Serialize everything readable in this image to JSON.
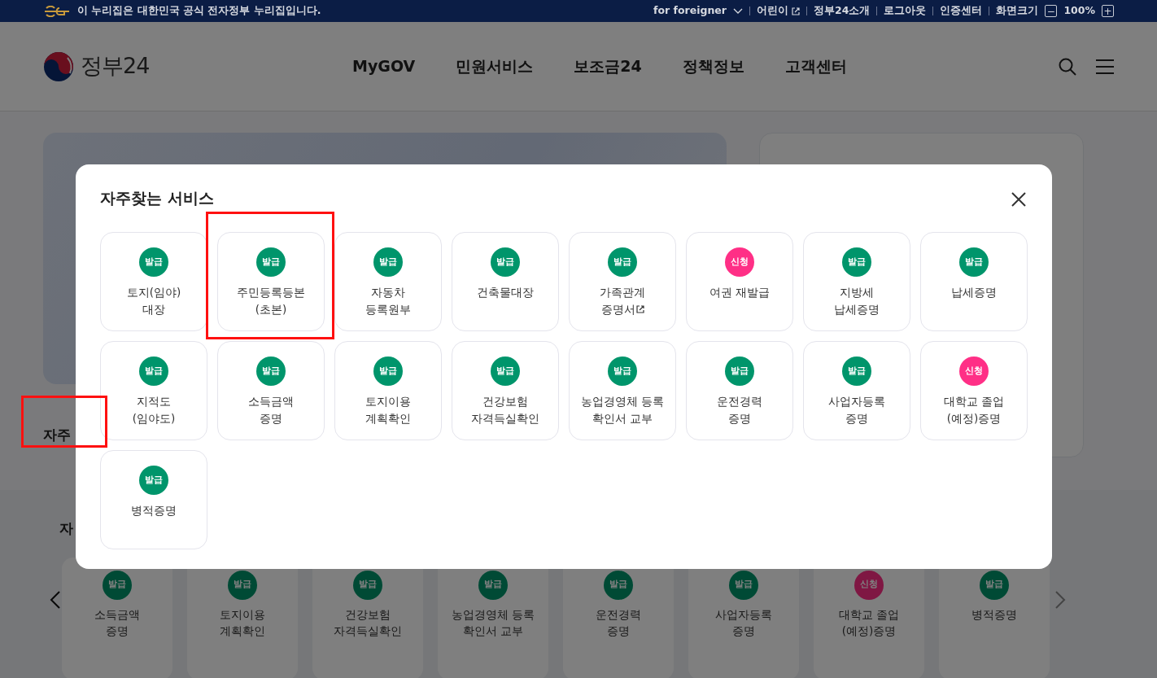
{
  "top_bar": {
    "notice": "이 누리집은 대한민국 공식 전자정부 누리집입니다.",
    "links": [
      {
        "label": "for foreigner",
        "kind": "dropdown"
      },
      {
        "label": "어린이",
        "kind": "external"
      },
      {
        "label": "정부24소개",
        "kind": "plain"
      },
      {
        "label": "로그아웃",
        "kind": "plain"
      },
      {
        "label": "인증센터",
        "kind": "plain"
      }
    ],
    "zoom": {
      "label": "화면크기",
      "decrease": "−",
      "value": "100%",
      "increase": "+"
    }
  },
  "header": {
    "logo": "정부24",
    "nav": [
      "MyGOV",
      "민원서비스",
      "보조금24",
      "정책정보",
      "고객센터"
    ]
  },
  "page": {
    "section_title": {
      "text": "자주",
      "highlighted": true
    },
    "lower_title": "자",
    "carousel": [
      {
        "badge": "발급",
        "kind": "issue",
        "label": "소득금액\n증명"
      },
      {
        "badge": "발급",
        "kind": "issue",
        "label": "토지이용\n계획확인"
      },
      {
        "badge": "발급",
        "kind": "issue",
        "label": "건강보험\n자격득실확인"
      },
      {
        "badge": "발급",
        "kind": "issue",
        "label": "농업경영체 등록\n확인서 교부"
      },
      {
        "badge": "발급",
        "kind": "issue",
        "label": "운전경력\n증명"
      },
      {
        "badge": "발급",
        "kind": "issue",
        "label": "사업자등록\n증명"
      },
      {
        "badge": "신청",
        "kind": "apply",
        "label": "대학교 졸업\n(예정)증명"
      },
      {
        "badge": "발급",
        "kind": "issue",
        "label": "병적증명"
      }
    ]
  },
  "modal": {
    "title": "자주찾는 서비스",
    "services": [
      {
        "badge": "발급",
        "kind": "issue",
        "label": "토지(임야)\n대장",
        "external": false,
        "highlighted": false
      },
      {
        "badge": "발급",
        "kind": "issue",
        "label": "주민등록등본\n(초본)",
        "external": false,
        "highlighted": true
      },
      {
        "badge": "발급",
        "kind": "issue",
        "label": "자동차\n등록원부",
        "external": false,
        "highlighted": false
      },
      {
        "badge": "발급",
        "kind": "issue",
        "label": "건축물대장",
        "external": false,
        "highlighted": false
      },
      {
        "badge": "발급",
        "kind": "issue",
        "label": "가족관계\n증명서",
        "external": true,
        "highlighted": false
      },
      {
        "badge": "신청",
        "kind": "apply",
        "label": "여권 재발급",
        "external": false,
        "highlighted": false
      },
      {
        "badge": "발급",
        "kind": "issue",
        "label": "지방세\n납세증명",
        "external": false,
        "highlighted": false
      },
      {
        "badge": "발급",
        "kind": "issue",
        "label": "납세증명",
        "external": false,
        "highlighted": false
      },
      {
        "badge": "발급",
        "kind": "issue",
        "label": "지적도\n(임야도)",
        "external": false,
        "highlighted": false
      },
      {
        "badge": "발급",
        "kind": "issue",
        "label": "소득금액\n증명",
        "external": false,
        "highlighted": false
      },
      {
        "badge": "발급",
        "kind": "issue",
        "label": "토지이용\n계획확인",
        "external": false,
        "highlighted": false
      },
      {
        "badge": "발급",
        "kind": "issue",
        "label": "건강보험\n자격득실확인",
        "external": false,
        "highlighted": false
      },
      {
        "badge": "발급",
        "kind": "issue",
        "label": "농업경영체 등록\n확인서 교부",
        "external": false,
        "highlighted": false
      },
      {
        "badge": "발급",
        "kind": "issue",
        "label": "운전경력\n증명",
        "external": false,
        "highlighted": false
      },
      {
        "badge": "발급",
        "kind": "issue",
        "label": "사업자등록\n증명",
        "external": false,
        "highlighted": false
      },
      {
        "badge": "신청",
        "kind": "apply",
        "label": "대학교 졸업\n(예정)증명",
        "external": false,
        "highlighted": false
      },
      {
        "badge": "발급",
        "kind": "issue",
        "label": "병적증명",
        "external": false,
        "highlighted": false
      }
    ]
  }
}
